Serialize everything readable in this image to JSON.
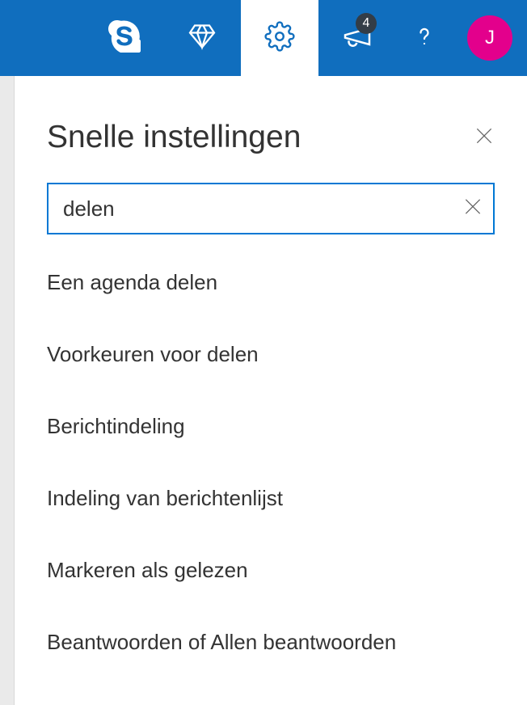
{
  "topbar": {
    "items": [
      {
        "name": "skype-icon"
      },
      {
        "name": "premium-icon"
      },
      {
        "name": "settings-icon",
        "active": true
      },
      {
        "name": "announcements-icon",
        "badge": "4"
      },
      {
        "name": "help-icon"
      }
    ],
    "avatar_initial": "J"
  },
  "panel": {
    "title": "Snelle instellingen",
    "close_name": "close-icon"
  },
  "search": {
    "value": "delen",
    "clear_name": "clear-search-icon"
  },
  "results": [
    {
      "label": "Een agenda delen"
    },
    {
      "label": "Voorkeuren voor delen"
    },
    {
      "label": "Berichtindeling"
    },
    {
      "label": "Indeling van berichtenlijst"
    },
    {
      "label": "Markeren als gelezen"
    },
    {
      "label": "Beantwoorden of Allen beantwoorden"
    }
  ]
}
